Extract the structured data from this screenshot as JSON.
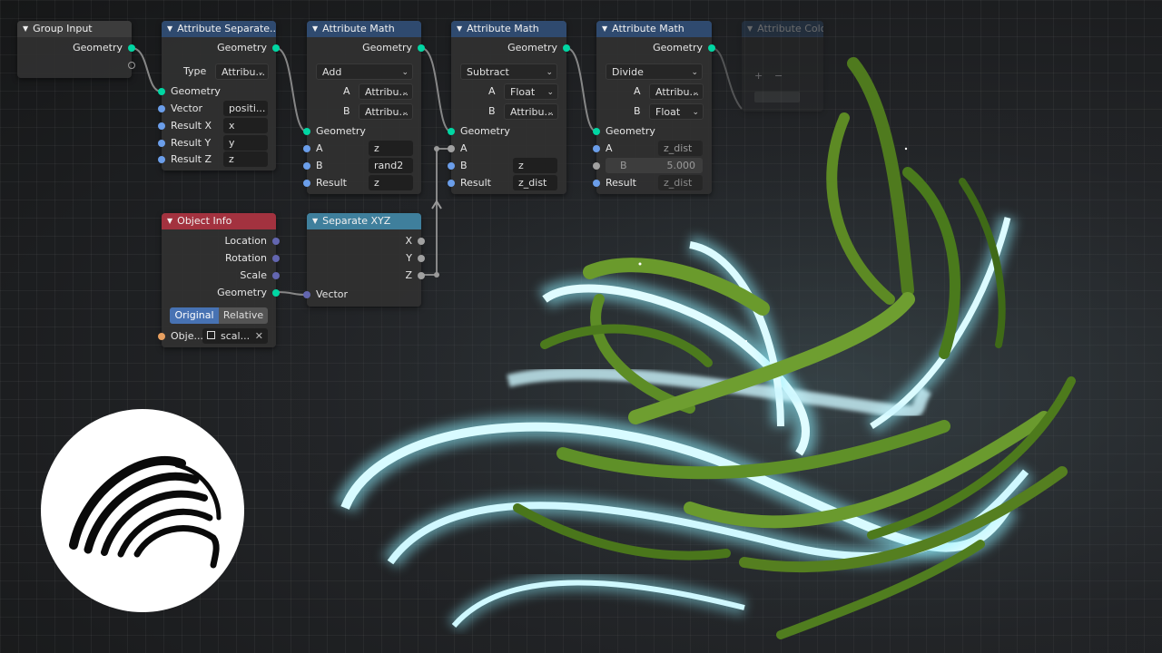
{
  "nodes": {
    "group_input": {
      "title": "Group Input",
      "geometry": "Geometry"
    },
    "attr_separate": {
      "title": "Attribute Separate...",
      "geometry_out": "Geometry",
      "type_label": "Type",
      "type_value": "Attribu...",
      "geometry_in": "Geometry",
      "vector_label": "Vector",
      "vector_value": "positi...",
      "rx_label": "Result X",
      "rx_value": "x",
      "ry_label": "Result Y",
      "ry_value": "y",
      "rz_label": "Result Z",
      "rz_value": "z"
    },
    "math1": {
      "title": "Attribute Math",
      "geometry_out": "Geometry",
      "op": "Add",
      "a_label": "A",
      "a_type": "Attribu...",
      "b_label": "B",
      "b_type": "Attribu...",
      "geometry_in": "Geometry",
      "a_in_label": "A",
      "a_in_value": "z",
      "b_in_label": "B",
      "b_in_value": "rand2",
      "result_label": "Result",
      "result_value": "z"
    },
    "math2": {
      "title": "Attribute Math",
      "geometry_out": "Geometry",
      "op": "Subtract",
      "a_label": "A",
      "a_type": "Float",
      "b_label": "B",
      "b_type": "Attribu...",
      "geometry_in": "Geometry",
      "a_in_label": "A",
      "b_in_label": "B",
      "b_in_value": "z",
      "result_label": "Result",
      "result_value": "z_dist"
    },
    "math3": {
      "title": "Attribute Math",
      "geometry_out": "Geometry",
      "op": "Divide",
      "a_label": "A",
      "a_type": "Attribu...",
      "b_label": "B",
      "b_type": "Float",
      "geometry_in": "Geometry",
      "a_in_label": "A",
      "a_in_value": "z_dist",
      "b_in_label": "B",
      "b_in_value": "5.000",
      "result_label": "Result",
      "result_value": "z_dist"
    },
    "color_ramp": {
      "title": "Attribute Color R...",
      "plus": "+",
      "minus": "−"
    },
    "object_info": {
      "title": "Object Info",
      "location": "Location",
      "rotation": "Rotation",
      "scale": "Scale",
      "geometry": "Geometry",
      "original": "Original",
      "relative": "Relative",
      "object_label": "Obje...",
      "object_value": "scal...",
      "clear": "✕"
    },
    "separate_xyz": {
      "title": "Separate XYZ",
      "x": "X",
      "y": "Y",
      "z": "Z",
      "vector": "Vector"
    }
  },
  "colors": {
    "geometry_socket": "#00d6a3",
    "vector_socket": "#6b9eea",
    "float_socket": "#a1a1a1",
    "object_socket": "#e8a060",
    "attribute_header": "#2f4a6f",
    "input_header": "#a3323f",
    "converter_header": "#3f7f9c"
  },
  "logo": {
    "icon": "brush-arcs-logo"
  }
}
